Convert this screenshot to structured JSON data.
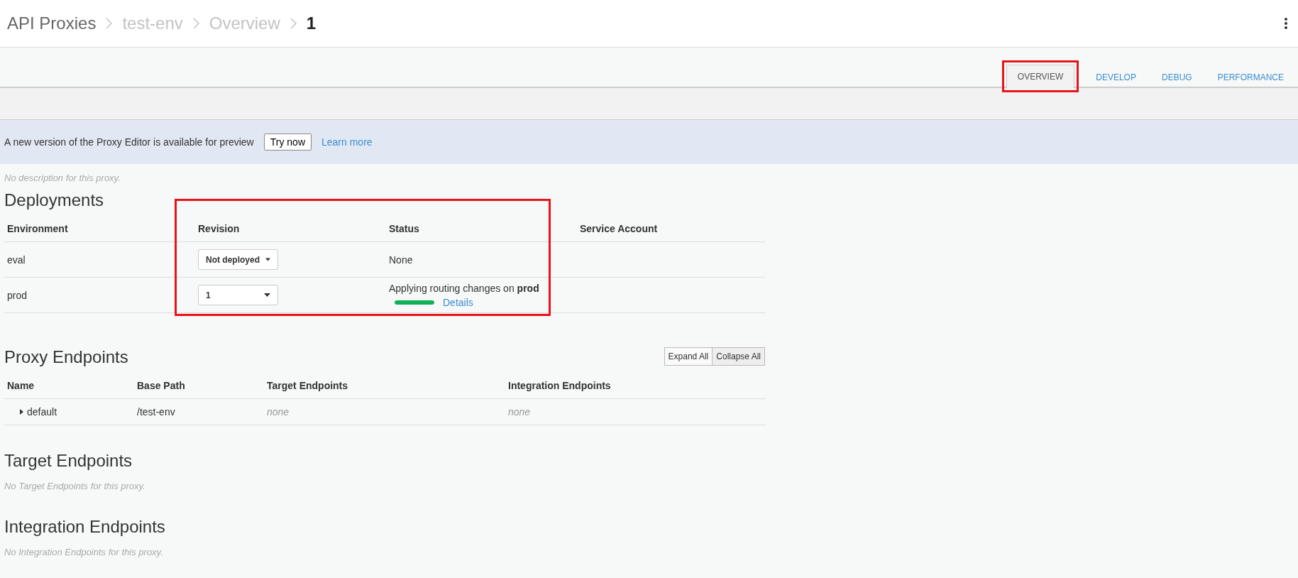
{
  "breadcrumb": [
    {
      "label": "API Proxies",
      "current": false
    },
    {
      "label": "test-env",
      "current": false
    },
    {
      "label": "Overview",
      "current": false
    },
    {
      "label": "1",
      "current": true
    }
  ],
  "tabs": [
    {
      "label": "OVERVIEW",
      "selected": true
    },
    {
      "label": "DEVELOP",
      "selected": false
    },
    {
      "label": "DEBUG",
      "selected": false
    },
    {
      "label": "PERFORMANCE",
      "selected": false
    }
  ],
  "banner": {
    "message": "A new version of the Proxy Editor is available for preview",
    "button": "Try now",
    "link": "Learn more"
  },
  "description": "No description for this proxy.",
  "deployments": {
    "title": "Deployments",
    "columns": [
      "Environment",
      "Revision",
      "Status",
      "Service Account"
    ],
    "rows": [
      {
        "environment": "eval",
        "revision": "Not deployed",
        "status": "None"
      },
      {
        "environment": "prod",
        "revision": "1",
        "status": "Applying routing changes on **prod**",
        "progress": {
          "level": 1
        },
        "link": "Details"
      }
    ]
  },
  "proxy_endpoints": {
    "title": "Proxy Endpoints",
    "buttons": [
      "Expand All",
      "Collapse All"
    ],
    "columns": [
      "Name",
      "Base Path",
      "Target Endpoints",
      "Integration Endpoints"
    ],
    "rows": [
      {
        "name": "default",
        "expanded": false,
        "base_path": "/test-env",
        "target_endpoints": "none",
        "integration_endpoints": "none"
      }
    ]
  },
  "target_endpoints": {
    "title": "Target Endpoints",
    "empty": "No Target Endpoints for this proxy."
  },
  "integration_endpoints": {
    "title": "Integration Endpoints",
    "empty": "No Integration Endpoints for this proxy."
  }
}
